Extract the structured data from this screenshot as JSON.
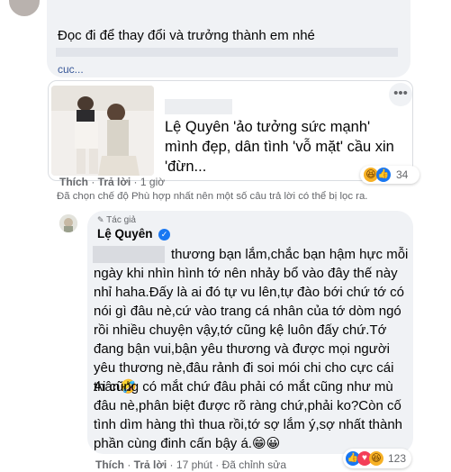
{
  "top_comment": {
    "text": "Đọc đi để thay đổi và trưởng thành em nhé",
    "more_label": "cuc..."
  },
  "link_preview": {
    "title": "Lệ Quyên 'ảo tưởng sức mạnh' mình đẹp, dân tình 'vỗ mặt' cầu xin 'đừn...",
    "more_icon": "ellipsis-icon",
    "reactions": {
      "icons": [
        "haha",
        "like"
      ],
      "count": "34"
    }
  },
  "comment_meta": {
    "like_label": "Thích",
    "separator": " · ",
    "reply_label": "Trả lời",
    "time": "1 giờ"
  },
  "filter_note": "Đã chọn chế độ Phù hợp nhất nên một số câu trả lời có thể bị lọc ra.",
  "reply": {
    "author_badge": "Tác giả",
    "author_name": "Lệ Quyên",
    "paragraph_1": "thương bạn lắm,chắc bạn hậm hực mỗi ngày khi nhìn hình tớ nên nhảy bổ vào đây thế này nhỉ haha.Đấy là ai đó tự vu lên,tự đào bới chứ tớ có nói gì đâu nè,cứ vào trang cá nhân của tớ dòm ngó rồi nhiều chuyện vậy,tớ cũng kệ luôn đấy chứ.Tớ đang bận vui,bận yêu thương và được mọi người yêu thương nè,đâu rảnh đi soi mói chi cho cực cái thân🤣",
    "paragraph_2": "Ai cũng có mắt chứ đâu phải có mắt cũng như mù đâu nè,phân biệt được rõ ràng chứ,phải ko?Còn cố tình dìm hàng thì thua rồi,tớ sợ lắm ý,sợ nhất thành phần cùng đinh cấn bậy á.😁😀",
    "reactions": {
      "icons": [
        "like",
        "love",
        "haha"
      ],
      "count": "123"
    },
    "meta": {
      "like_label": "Thích",
      "reply_label": "Trả lời",
      "time": "17 phút",
      "edited_label": "Đã chỉnh sửa"
    }
  },
  "colors": {
    "bubble": "#f0f2f5",
    "meta_text": "#65676b",
    "link": "#385898",
    "like_blue": "#1877f2",
    "love_red": "#f33e58",
    "haha_yellow": "#f7b125"
  }
}
